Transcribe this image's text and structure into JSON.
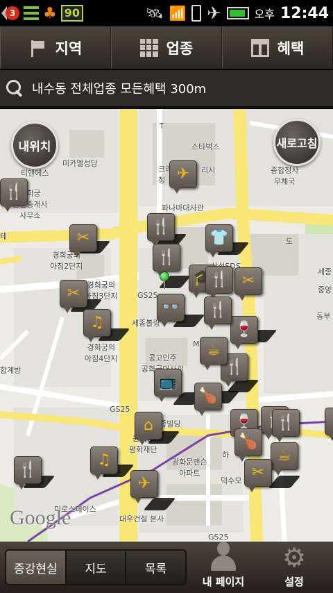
{
  "status_bar": {
    "notification_count": "3",
    "number_badge": "90",
    "ampm": "오후",
    "time": "12:44"
  },
  "top_tabs": [
    {
      "label": "지역",
      "icon": "flag-icon"
    },
    {
      "label": "업종",
      "icon": "grid-icon"
    },
    {
      "label": "혜택",
      "icon": "gift-icon"
    }
  ],
  "search": {
    "query": "내수동 전체업종 모든혜택 300m"
  },
  "map": {
    "my_location_button": "내위치",
    "refresh_button": "새로고침",
    "watermark": "Google",
    "labels": {
      "tianmes": "티앤에스",
      "michael_church": "미카엘성당",
      "gyeonghuigung_office": "경희궁\n공인중개사\n사무소",
      "gyeonghuigung_apt2": "경희궁의\n아침2단지",
      "gyeonghuigung_apt3": "경희궁의\n아침3단지",
      "gyeonghuigung_apt4": "경희궁의\n아침4단지",
      "hapgyebang": "합계방",
      "starbucks": "스타벅스",
      "krishirae": "크리\n정",
      "rishi": "리시",
      "jongno_post": "종합청사\n우체국",
      "pineapple": "파나마대사관",
      "samsung_sds": "삼성SDS",
      "gs25_a": "GS25",
      "gs25_b": "GS25",
      "gs25_c": "GS25",
      "sejongbol": "세종볼링",
      "costa_rica": "콩고민주\n공화국대사관",
      "building": "종빌딩",
      "unification": "윤이상\n평화재단",
      "gwanghwamun": "광화문맨슨\n아파트",
      "ha": "하",
      "deoksu": "덕수모",
      "daewoo": "대우건설 본사",
      "microspace": "미로스페이스",
      "sej": "세종",
      "jungang": "중앙",
      "dongbu": "동부",
      "el": "테",
      "t": "T",
      "doing": "도",
      "mi": "M"
    }
  },
  "bottom_bar": {
    "segments": [
      {
        "label": "증강현실",
        "active": true
      },
      {
        "label": "지도",
        "active": false
      },
      {
        "label": "목록",
        "active": false
      }
    ],
    "my_page_label": "내 페이지",
    "settings_label": "설정"
  },
  "colors": {
    "pin_icon": "#f2b51f",
    "road_yellow": "#f8e676",
    "road_white": "#ffffff",
    "map_bg": "#ecebe6",
    "park_green": "#cfe6b0",
    "building": "#dcdad3",
    "subway_line": "#7b3fa8"
  },
  "pins": [
    {
      "id": "pin-scissors-1",
      "icon": "scissors-icon",
      "glyph": "✂"
    },
    {
      "id": "pin-scissors-2",
      "icon": "scissors-icon",
      "glyph": "✂"
    },
    {
      "id": "pin-music-1",
      "icon": "music-icon",
      "glyph": "♫"
    },
    {
      "id": "pin-music-2",
      "icon": "music-icon",
      "glyph": "♫"
    },
    {
      "id": "pin-plane-1",
      "icon": "airplane-icon",
      "glyph": "✈"
    },
    {
      "id": "pin-plane-2",
      "icon": "airplane-icon",
      "glyph": "✈"
    },
    {
      "id": "pin-fork-1",
      "icon": "fork-knife-icon",
      "glyph": "🍴"
    },
    {
      "id": "pin-fork-2",
      "icon": "fork-knife-icon",
      "glyph": "🍴"
    },
    {
      "id": "pin-fork-3",
      "icon": "fork-knife-icon",
      "glyph": "🍴"
    },
    {
      "id": "pin-fork-4",
      "icon": "fork-knife-icon",
      "glyph": "🍴"
    },
    {
      "id": "pin-shirt",
      "icon": "shirt-icon",
      "glyph": "👕"
    },
    {
      "id": "pin-grad",
      "icon": "graduation-cap-icon",
      "glyph": "🎓"
    },
    {
      "id": "pin-glasses",
      "icon": "glasses-icon",
      "glyph": "👓"
    },
    {
      "id": "pin-coffee-1",
      "icon": "coffee-icon",
      "glyph": "☕"
    },
    {
      "id": "pin-coffee-2",
      "icon": "coffee-icon",
      "glyph": "☕"
    },
    {
      "id": "pin-wine-1",
      "icon": "wine-icon",
      "glyph": "🍷"
    },
    {
      "id": "pin-wine-2",
      "icon": "wine-icon",
      "glyph": "🍷"
    },
    {
      "id": "pin-tv",
      "icon": "tv-icon",
      "glyph": "📺"
    },
    {
      "id": "pin-home",
      "icon": "home-icon",
      "glyph": "⌂"
    },
    {
      "id": "pin-food",
      "icon": "food-icon",
      "glyph": "🍗"
    },
    {
      "id": "pin-scissors-3",
      "icon": "scissors-icon",
      "glyph": "✂"
    },
    {
      "id": "pin-scissors-4",
      "icon": "scissors-icon",
      "glyph": "✂"
    }
  ]
}
